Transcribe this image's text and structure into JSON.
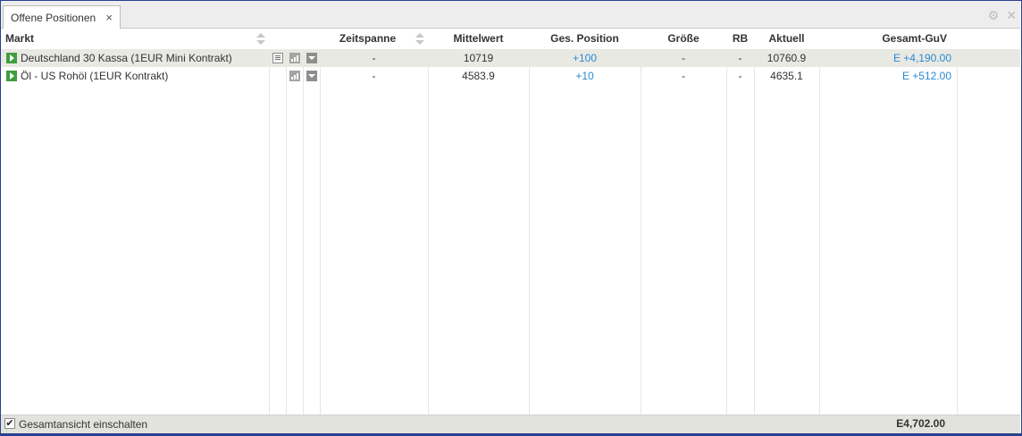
{
  "tab": {
    "title": "Offene Positionen",
    "close": "×"
  },
  "window_icons": {
    "settings": "⚙",
    "close": "✕"
  },
  "columns": {
    "markt": "Markt",
    "zeitspanne": "Zeitspanne",
    "mittelwert": "Mittelwert",
    "ges_position": "Ges. Position",
    "groesse": "Größe",
    "rb": "RB",
    "aktuell": "Aktuell",
    "gesamt_guv": "Gesamt-GuV"
  },
  "rows": [
    {
      "markt": "Deutschland 30 Kassa (1EUR Mini Kontrakt)",
      "zeitspanne": "-",
      "mittelwert": "10719",
      "ges_position": "+100",
      "groesse": "-",
      "rb": "-",
      "aktuell": "10760.9",
      "gesamt_guv": "E +4,190.00"
    },
    {
      "markt": "Öl - US Rohöl (1EUR Kontrakt)",
      "zeitspanne": "-",
      "mittelwert": "4583.9",
      "ges_position": "+10",
      "groesse": "-",
      "rb": "-",
      "aktuell": "4635.1",
      "gesamt_guv": "E +512.00"
    }
  ],
  "footer": {
    "checkbox_label": "Gesamtansicht einschalten",
    "checked": true,
    "total": "E4,702.00"
  },
  "colors": {
    "positive": "#2a8ad0",
    "selected_row": "#e9e9e4",
    "go_icon": "#3e9d3e"
  }
}
